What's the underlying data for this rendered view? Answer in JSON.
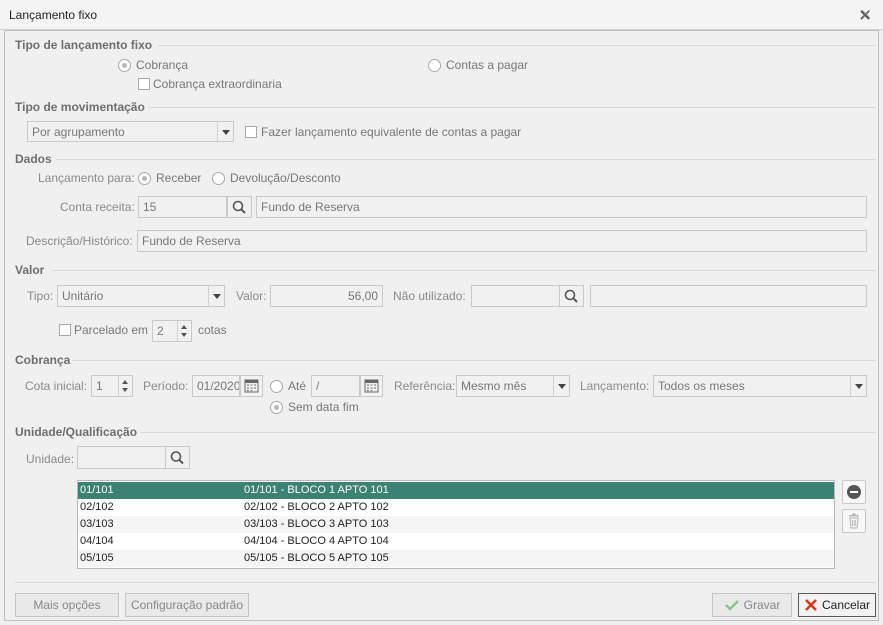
{
  "window": {
    "title": "Lançamento fixo"
  },
  "tipo_lancamento": {
    "section": "Tipo de lançamento fixo",
    "cobranca": "Cobrança",
    "extraordinaria": "Cobrança extraordinaria",
    "contas_pagar": "Contas a pagar"
  },
  "movimentacao": {
    "section": "Tipo de movimentação",
    "select_value": "Por agrupamento",
    "equivalente": "Fazer lançamento equivalente de contas a pagar"
  },
  "dados": {
    "section": "Dados",
    "lancamento_para_label": "Lançamento para:",
    "receber": "Receber",
    "devolucao": "Devolução/Desconto",
    "conta_receita_label": "Conta receita:",
    "conta_code": "15",
    "conta_desc": "Fundo  de Reserva",
    "descricao_label": "Descrição/Histórico:",
    "descricao_value": "Fundo  de Reserva"
  },
  "valor": {
    "section": "Valor",
    "tipo_label": "Tipo:",
    "tipo_value": "Unitário",
    "valor_label": "Valor:",
    "valor_value": "56,00",
    "nao_utilizado_label": "Não utilizado:",
    "nao_utilizado_value": "",
    "nao_utilizado_desc": "",
    "parcelado_label": "Parcelado em",
    "parcelas": "2",
    "cotas": "cotas"
  },
  "cobranca": {
    "section": "Cobrança",
    "cota_inicial_label": "Cota inicial:",
    "cota_inicial": "1",
    "periodo_label": "Período:",
    "periodo_inicio": "01/2020",
    "ate_label": "Até",
    "periodo_fim": "  /",
    "sem_data_fim": "Sem data fim",
    "referencia_label": "Referência:",
    "referencia_value": "Mesmo mês",
    "lancamento_label": "Lançamento:",
    "lancamento_value": "Todos os meses"
  },
  "unidade": {
    "section": "Unidade/Qualificação",
    "unidade_label": "Unidade:",
    "unidade_value": "",
    "rows": [
      {
        "code": "01/101",
        "desc": "01/101 - BLOCO 1 APTO 101"
      },
      {
        "code": "02/102",
        "desc": "02/102 - BLOCO 2 APTO 102"
      },
      {
        "code": "03/103",
        "desc": "03/103 - BLOCO 3 APTO 103"
      },
      {
        "code": "04/104",
        "desc": "04/104 - BLOCO 4 APTO 104"
      },
      {
        "code": "05/105",
        "desc": "05/105 - BLOCO 5 APTO 105"
      }
    ]
  },
  "footer": {
    "mais_opcoes": "Mais opções",
    "config_padrao": "Configuração padrão",
    "gravar": "Gravar",
    "cancelar": "Cancelar"
  },
  "colors": {
    "selected_row": "#3c8272",
    "cancel_icon": "#d23a1e",
    "check_icon": "#8ac08a"
  }
}
